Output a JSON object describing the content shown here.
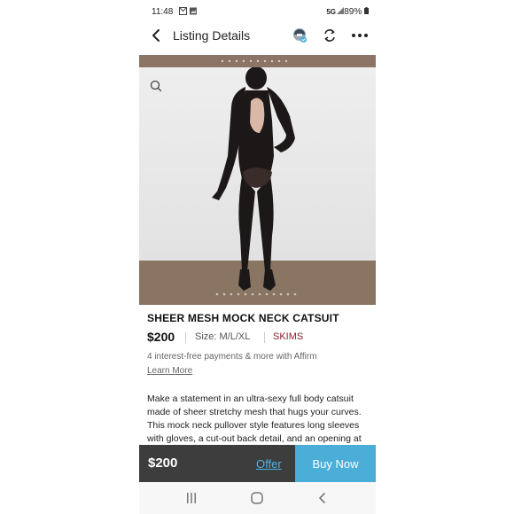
{
  "status_bar": {
    "time": "11:48",
    "network": "5G",
    "battery": "89%"
  },
  "header": {
    "title": "Listing Details"
  },
  "product": {
    "title": "SHEER MESH MOCK NECK CATSUIT",
    "price": "$200",
    "size": "Size: M/L/XL",
    "brand": "SKIMS",
    "affirm_text": "4 interest-free payments & more with Affirm",
    "learn_more": "Learn More",
    "description": "Make a statement in an ultra-sexy full body catsuit made of sheer stretchy mesh that hugs your curves. This mock neck pullover style features long sleeves with gloves, a cut-out back detail, and an opening at gusset that extends to lower"
  },
  "bottom_bar": {
    "price": "$200",
    "offer_label": "Offer",
    "buy_label": "Buy Now"
  },
  "colors": {
    "brand": "#8b1c2c",
    "buy_button": "#4aaed9",
    "offer_link": "#4db3e6",
    "bottom_bar": "#3d3d3d"
  }
}
